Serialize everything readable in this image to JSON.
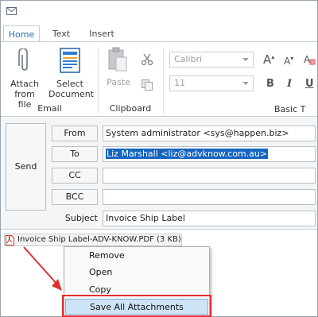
{
  "tabs": [
    "Home",
    "Text",
    "Insert"
  ],
  "ribbon": {
    "attach_file": [
      "Attach",
      "from file"
    ],
    "select_document": [
      "Select",
      "Document"
    ],
    "email_group": "Email",
    "paste": "Paste",
    "clipboard_group": "Clipboard",
    "font_name": "Calibri",
    "font_size": "11",
    "basic_text_group": "Basic T",
    "grow_font": "A",
    "shrink_font": "A",
    "bold": "B",
    "italic": "I",
    "underline": "U"
  },
  "compose": {
    "send_label": "Send",
    "from_label": "From",
    "from_value": "System administrator <sys@happen.biz>",
    "to_label": "To",
    "to_value": "Liz Marshall <liz@advknow.com.au>",
    "cc_label": "CC",
    "cc_value": "",
    "bcc_label": "BCC",
    "bcc_value": "",
    "subject_label": "Subject",
    "subject_value": "Invoice Ship Label"
  },
  "attachment": {
    "name": "Invoice Ship Label-ADV-KNOW.PDF (3 KB)"
  },
  "context_menu": {
    "items": [
      "Remove",
      "Open",
      "Copy",
      "Save All Attachments"
    ]
  },
  "colors": {
    "accent": "#2b6cb5",
    "selection": "#1565c0",
    "highlight_outline": "#e03030",
    "menu_hover": "#cde4f7"
  }
}
